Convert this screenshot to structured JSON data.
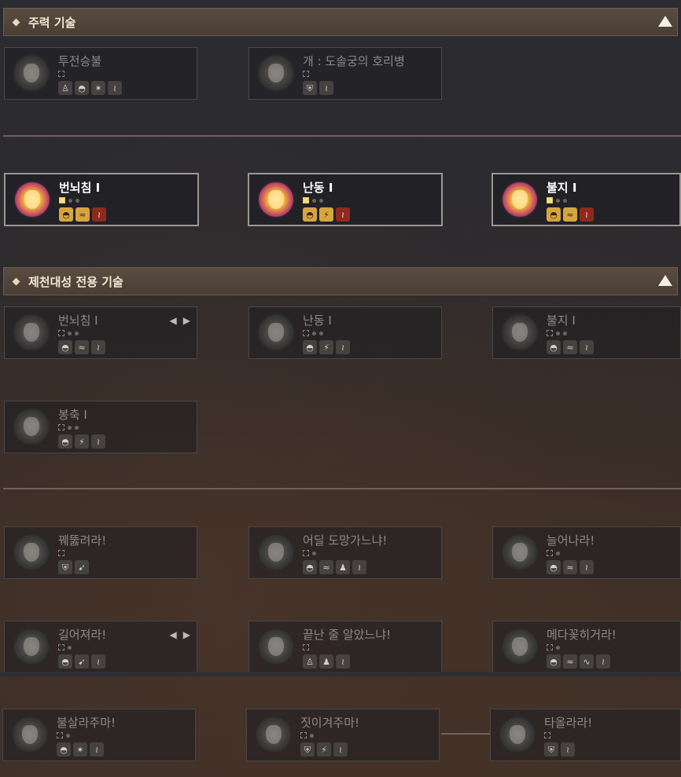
{
  "sections": {
    "main_skills": {
      "title": "주력 기술"
    },
    "exclusive_skills": {
      "title": "제천대성 전용 기술"
    }
  },
  "colors": {
    "active_border": "#9b9793",
    "header_bg": "#5a4c41",
    "text_dim": "#8d8a86"
  },
  "cards": {
    "c1": {
      "name": "투전승불",
      "icons": [
        "body-icon",
        "mask-icon",
        "tiger-icon",
        "claw-icon"
      ]
    },
    "c2": {
      "name": "개 : 도솔궁의 호리병",
      "icons": [
        "shield-icon",
        "claw-icon"
      ]
    },
    "c3": {
      "name": "번뇌침 I",
      "icons": [
        "mask-icon",
        "wave-icon",
        "claw-icon"
      ]
    },
    "c4": {
      "name": "난동 I",
      "icons": [
        "mask-icon",
        "strike-icon",
        "claw-icon"
      ]
    },
    "c5": {
      "name": "불지 I",
      "icons": [
        "mask-icon",
        "wave-icon",
        "claw-icon"
      ]
    },
    "c6": {
      "name": "번뇌침 I",
      "icons": [
        "mask-icon",
        "wave-icon",
        "claw-icon"
      ]
    },
    "c7": {
      "name": "난동 I",
      "icons": [
        "mask-icon",
        "strike-icon",
        "claw-icon"
      ]
    },
    "c8": {
      "name": "불지 I",
      "icons": [
        "mask-icon",
        "wave-icon",
        "claw-icon"
      ]
    },
    "c9": {
      "name": "봉축 I",
      "icons": [
        "mask-icon",
        "strike-icon",
        "claw-icon"
      ]
    },
    "c10": {
      "name": "꿰뚫려라!",
      "icons": [
        "shield-icon",
        "run-icon"
      ]
    },
    "c11": {
      "name": "어딜 도망가느냐!",
      "icons": [
        "mask-icon",
        "wave-icon",
        "figure-icon",
        "claw-icon"
      ]
    },
    "c12": {
      "name": "늘어나라!",
      "icons": [
        "mask-icon",
        "wave-icon",
        "claw-icon"
      ]
    },
    "c13": {
      "name": "길어져라!",
      "icons": [
        "mask-icon",
        "run-icon",
        "claw-icon"
      ]
    },
    "c14": {
      "name": "끝난 줄 알았느냐!",
      "icons": [
        "body-icon",
        "figure-icon",
        "claw-icon"
      ]
    },
    "c15": {
      "name": "메다꽂히거라!",
      "icons": [
        "mask-icon",
        "wave-icon",
        "whip-icon",
        "claw-icon"
      ]
    },
    "c16": {
      "name": "불살라주마!",
      "icons": [
        "mask-icon",
        "tiger-icon",
        "claw-icon"
      ]
    },
    "c17": {
      "name": "짓이겨주마!",
      "icons": [
        "shield-icon",
        "strike-icon",
        "claw-icon"
      ]
    },
    "c18": {
      "name": "타올라라!",
      "icons": [
        "shield-icon",
        "claw-icon"
      ]
    }
  }
}
